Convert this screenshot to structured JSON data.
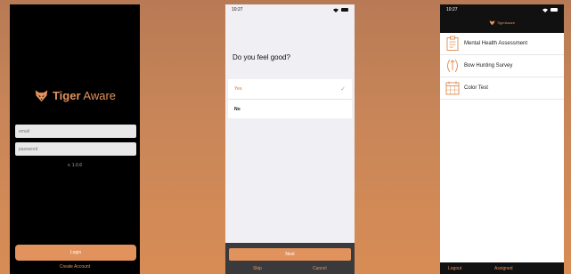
{
  "colors": {
    "accent": "#e2935d",
    "dark": "#000000",
    "tabbar": "#3a3a3c"
  },
  "login": {
    "brand_bold": "Tiger",
    "brand_light": " Aware",
    "email_placeholder": "email",
    "password_placeholder": "password",
    "version": "v. 1.0.6",
    "login_label": "Login",
    "create_account_label": "Create Account"
  },
  "survey": {
    "time": "10:27",
    "question": "Do you feel good?",
    "answers": [
      {
        "label": "Yes",
        "selected": true
      },
      {
        "label": "No",
        "selected": false
      }
    ],
    "check_icon": "checkmark-icon",
    "next_label": "Next",
    "skip_label": "Skip",
    "cancel_label": "Cancel"
  },
  "list": {
    "time": "10:27",
    "brand": "TigerAware",
    "items": [
      {
        "label": "Mental Health Assessment",
        "icon": "clipboard-icon"
      },
      {
        "label": "Bow Hunting Survey",
        "icon": "bow-hunting-icon"
      },
      {
        "label": "Color Test",
        "icon": "calendar-icon"
      }
    ],
    "logout_label": "Logout",
    "assigned_label": "Assigned"
  }
}
